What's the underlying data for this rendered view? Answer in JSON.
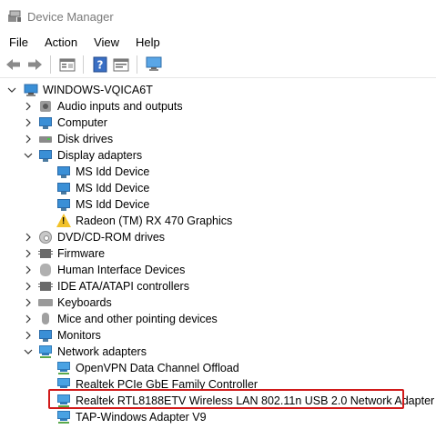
{
  "window": {
    "title": "Device Manager"
  },
  "menu": [
    "File",
    "Action",
    "View",
    "Help"
  ],
  "toolbar": {
    "buttons": [
      "back-arrow-icon",
      "forward-arrow-icon",
      "properties-icon",
      "help-icon",
      "update-driver-icon",
      "scan-monitor-icon"
    ]
  },
  "tree": {
    "root": "WINDOWS-VQICA6T",
    "items": [
      {
        "label": "Audio inputs and outputs",
        "icon": "speaker-icon",
        "state": "collapsed"
      },
      {
        "label": "Computer",
        "icon": "monitor-icon",
        "state": "collapsed"
      },
      {
        "label": "Disk drives",
        "icon": "disk-icon",
        "state": "collapsed"
      },
      {
        "label": "Display adapters",
        "icon": "monitor-icon",
        "state": "expanded",
        "children": [
          {
            "label": "MS Idd Device",
            "icon": "monitor-icon"
          },
          {
            "label": "MS Idd Device",
            "icon": "monitor-icon"
          },
          {
            "label": "MS Idd Device",
            "icon": "monitor-icon"
          },
          {
            "label": "Radeon (TM) RX 470 Graphics",
            "icon": "warning-icon"
          }
        ]
      },
      {
        "label": "DVD/CD-ROM drives",
        "icon": "cd-icon",
        "state": "collapsed"
      },
      {
        "label": "Firmware",
        "icon": "chip-icon",
        "state": "collapsed"
      },
      {
        "label": "Human Interface Devices",
        "icon": "hid-icon",
        "state": "collapsed"
      },
      {
        "label": "IDE ATA/ATAPI controllers",
        "icon": "chip-icon",
        "state": "collapsed"
      },
      {
        "label": "Keyboards",
        "icon": "keyboard-icon",
        "state": "collapsed"
      },
      {
        "label": "Mice and other pointing devices",
        "icon": "mouse-icon",
        "state": "collapsed"
      },
      {
        "label": "Monitors",
        "icon": "monitor-icon",
        "state": "collapsed"
      },
      {
        "label": "Network adapters",
        "icon": "network-icon",
        "state": "expanded",
        "children": [
          {
            "label": "OpenVPN Data Channel Offload",
            "icon": "network-icon"
          },
          {
            "label": "Realtek PCIe GbE Family Controller",
            "icon": "network-icon"
          },
          {
            "label": "Realtek RTL8188ETV Wireless LAN 802.11n USB 2.0 Network Adapter",
            "icon": "network-icon",
            "highlighted": true
          },
          {
            "label": "TAP-Windows Adapter V9",
            "icon": "network-icon"
          }
        ]
      }
    ]
  },
  "colors": {
    "highlight": "#d11a1a",
    "title_text": "#7a7a7a"
  }
}
